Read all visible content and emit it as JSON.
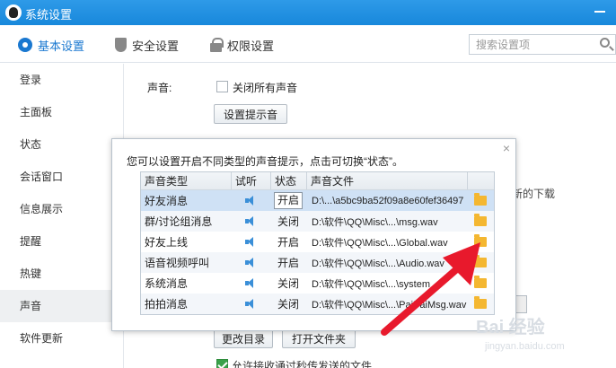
{
  "window": {
    "title": "系统设置"
  },
  "topbar": {
    "tabs": [
      {
        "label": "基本设置",
        "icon": "gear-icon",
        "active": true
      },
      {
        "label": "安全设置",
        "icon": "shield-icon",
        "active": false
      },
      {
        "label": "权限设置",
        "icon": "lock-icon",
        "active": false
      }
    ],
    "search_placeholder": "搜索设置项"
  },
  "sidebar": {
    "items": [
      {
        "label": "登录"
      },
      {
        "label": "主面板"
      },
      {
        "label": "状态"
      },
      {
        "label": "会话窗口"
      },
      {
        "label": "信息展示"
      },
      {
        "label": "提醒"
      },
      {
        "label": "热键"
      },
      {
        "label": "声音",
        "active": true
      },
      {
        "label": "软件更新"
      }
    ]
  },
  "main": {
    "sound_label": "声音:",
    "mute_all_label": "关闭所有声音",
    "set_prompt_button": "设置提示音",
    "new_download_text": "新的下载",
    "change_dir_button": "更改目录",
    "open_folder_button": "打开文件夹",
    "agree_text": "允许接收通过秒传发送的文件"
  },
  "dialog": {
    "heading": "您可以设置开启不同类型的声音提示，点击可切换“状态”。",
    "close": "×",
    "columns": [
      "声音类型",
      "试听",
      "状态",
      "声音文件"
    ],
    "rows": [
      {
        "type": "好友消息",
        "status": "开启",
        "file": "D:\\...\\a5bc9ba52f09a8e60fef36497",
        "selected": true
      },
      {
        "type": "群/讨论组消息",
        "status": "关闭",
        "file": "D:\\软件\\QQ\\Misc\\...\\msg.wav"
      },
      {
        "type": "好友上线",
        "status": "开启",
        "file": "D:\\软件\\QQ\\Misc\\...\\Global.wav"
      },
      {
        "type": "语音视频呼叫",
        "status": "开启",
        "file": "D:\\软件\\QQ\\Misc\\...\\Audio.wav"
      },
      {
        "type": "系统消息",
        "status": "关闭",
        "file": "D:\\软件\\QQ\\Misc\\...\\system"
      },
      {
        "type": "拍拍消息",
        "status": "关闭",
        "file": "D:\\软件\\QQ\\Misc\\...\\PaiPaiMsg.wav"
      }
    ]
  },
  "watermark": {
    "brand": "Bai 经验",
    "url": "jingyan.baidu.com"
  },
  "colors": {
    "title_bar": "#1e8fe0",
    "accent": "#1a78d0",
    "arrow": "#e8192c",
    "folder": "#f4b731"
  }
}
